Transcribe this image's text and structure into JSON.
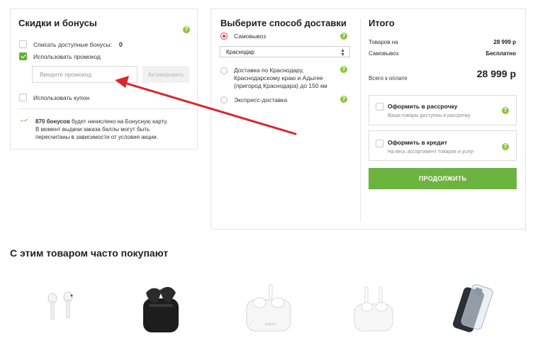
{
  "discounts": {
    "title": "Скидки и бонусы",
    "help": "?",
    "bonuses_label": "Списать доступные бонусы:",
    "bonuses_value": "0",
    "promo_label": "Использовать промокод",
    "promo_placeholder": "Введите промокод",
    "activate_label": "Активировать",
    "coupon_label": "Использовать купон",
    "bonus_count": "870 бонусов",
    "bonus_line1": " будет начислено на Бонусную карту.",
    "bonus_line2": "В момент выдачи заказа баллы могут быть",
    "bonus_line3": "пересчитаны в зависимости от условия акции."
  },
  "delivery": {
    "title": "Выберите способ доставки",
    "option_pickup": "Самовывоз",
    "city": "Краснодар",
    "option_courier_line1": "Доставка по Краснодару,",
    "option_courier_line2": "Краснодарскому краю и Адыгее",
    "option_courier_line3": "(пригород Краснодара) до 150 км",
    "option_express": "Экспресс-доставка"
  },
  "total": {
    "title": "Итого",
    "items_label": "Товаров на",
    "items_value": "28 999 р",
    "pickup_label": "Самовывоз",
    "pickup_value": "Бесплатно",
    "sum_label": "Всего к оплате",
    "sum_value": "28 999 р",
    "installment_title": "Оформить в рассрочку",
    "installment_sub": "Ваши товары доступны в рассрочку",
    "credit_title": "Оформить в кредит",
    "credit_sub": "На весь ассортимент товаров и услуг",
    "continue_label": "ПРОДОЛЖИТЬ"
  },
  "related": {
    "title": "С этим товаром часто покупают",
    "products": [
      "earbuds-white-icon",
      "earbuds-black-case-icon",
      "earbuds-white-case-icon",
      "earbuds-white-open-icon",
      "phone-case-icon"
    ]
  },
  "colors": {
    "accent": "#6cb33f",
    "arrow": "#d9262c",
    "radio_selected": "#e33b3b"
  }
}
